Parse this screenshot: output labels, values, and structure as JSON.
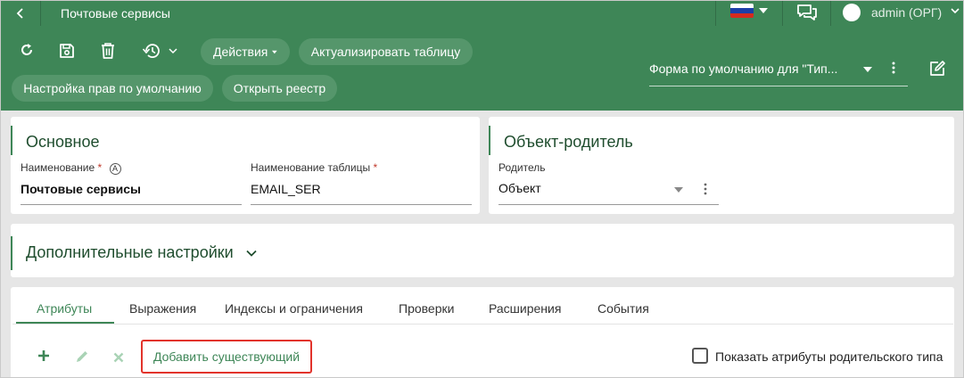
{
  "header": {
    "title": "Почтовые сервисы",
    "user": "admin (ОРГ)",
    "language_flag": "ru",
    "flag_colors": [
      "#ffffff",
      "#1c3fa8",
      "#d52b1e"
    ]
  },
  "toolbar": {
    "actions_label": "Действия",
    "refresh_table_label": "Актуализировать таблицу",
    "default_rights_label": "Настройка прав по умолчанию",
    "open_registry_label": "Открыть реестр",
    "form_select_value": "Форма по умолчанию для \"Тип..."
  },
  "main_card": {
    "title": "Основное",
    "name_label": "Наименование",
    "name_value": "Почтовые сервисы",
    "table_name_label": "Наименование таблицы",
    "table_name_value": "EMAIL_SER",
    "required_mark": "*",
    "auto_icon_letter": "A"
  },
  "parent_card": {
    "title": "Объект-родитель",
    "parent_label": "Родитель",
    "parent_value": "Объект"
  },
  "extra_card": {
    "title": "Дополнительные настройки"
  },
  "tabs": [
    {
      "label": "Атрибуты",
      "active": true
    },
    {
      "label": "Выражения",
      "active": false
    },
    {
      "label": "Индексы и ограничения",
      "active": false
    },
    {
      "label": "Проверки",
      "active": false
    },
    {
      "label": "Расширения",
      "active": false
    },
    {
      "label": "События",
      "active": false
    }
  ],
  "attributes": {
    "add_existing_label": "Добавить существующий",
    "show_parent_attrs_label": "Показать атрибуты родительского типа",
    "show_parent_attrs_checked": false
  },
  "colors": {
    "brand": "#3e8657",
    "highlight": "#e2332b"
  }
}
